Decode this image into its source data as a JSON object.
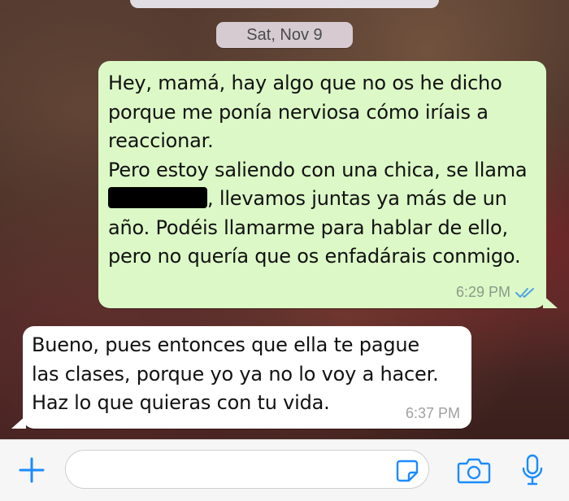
{
  "chat": {
    "date_separator": "Sat, Nov 9",
    "messages": [
      {
        "direction": "outgoing",
        "lines": [
          "Hey, mamá, hay algo que no os he dicho",
          "porque me ponía nerviosa cómo iríais a",
          "reaccionar.",
          "Pero estoy saliendo con una chica, se llama",
          ", llevamos juntas ya más de un",
          "año. Podéis llamarme para hablar de ello,",
          "pero no quería que os enfadárais conmigo."
        ],
        "time": "6:29 PM",
        "status": "read"
      },
      {
        "direction": "incoming",
        "lines": [
          "Bueno, pues entonces que ella te pague",
          "las clases, porque yo ya no lo voy a hacer.",
          "Haz lo que quieras con tu vida."
        ],
        "time": "6:37 PM"
      }
    ]
  },
  "input_bar": {
    "text_value": "",
    "icons": [
      "plus-icon",
      "sticker-icon",
      "camera-icon",
      "microphone-icon"
    ]
  },
  "colors": {
    "accent": "#1a8cff",
    "outgoing_bubble": "#dcf8c6",
    "incoming_bubble": "#ffffff",
    "read_ticks": "#4fa3e3"
  }
}
